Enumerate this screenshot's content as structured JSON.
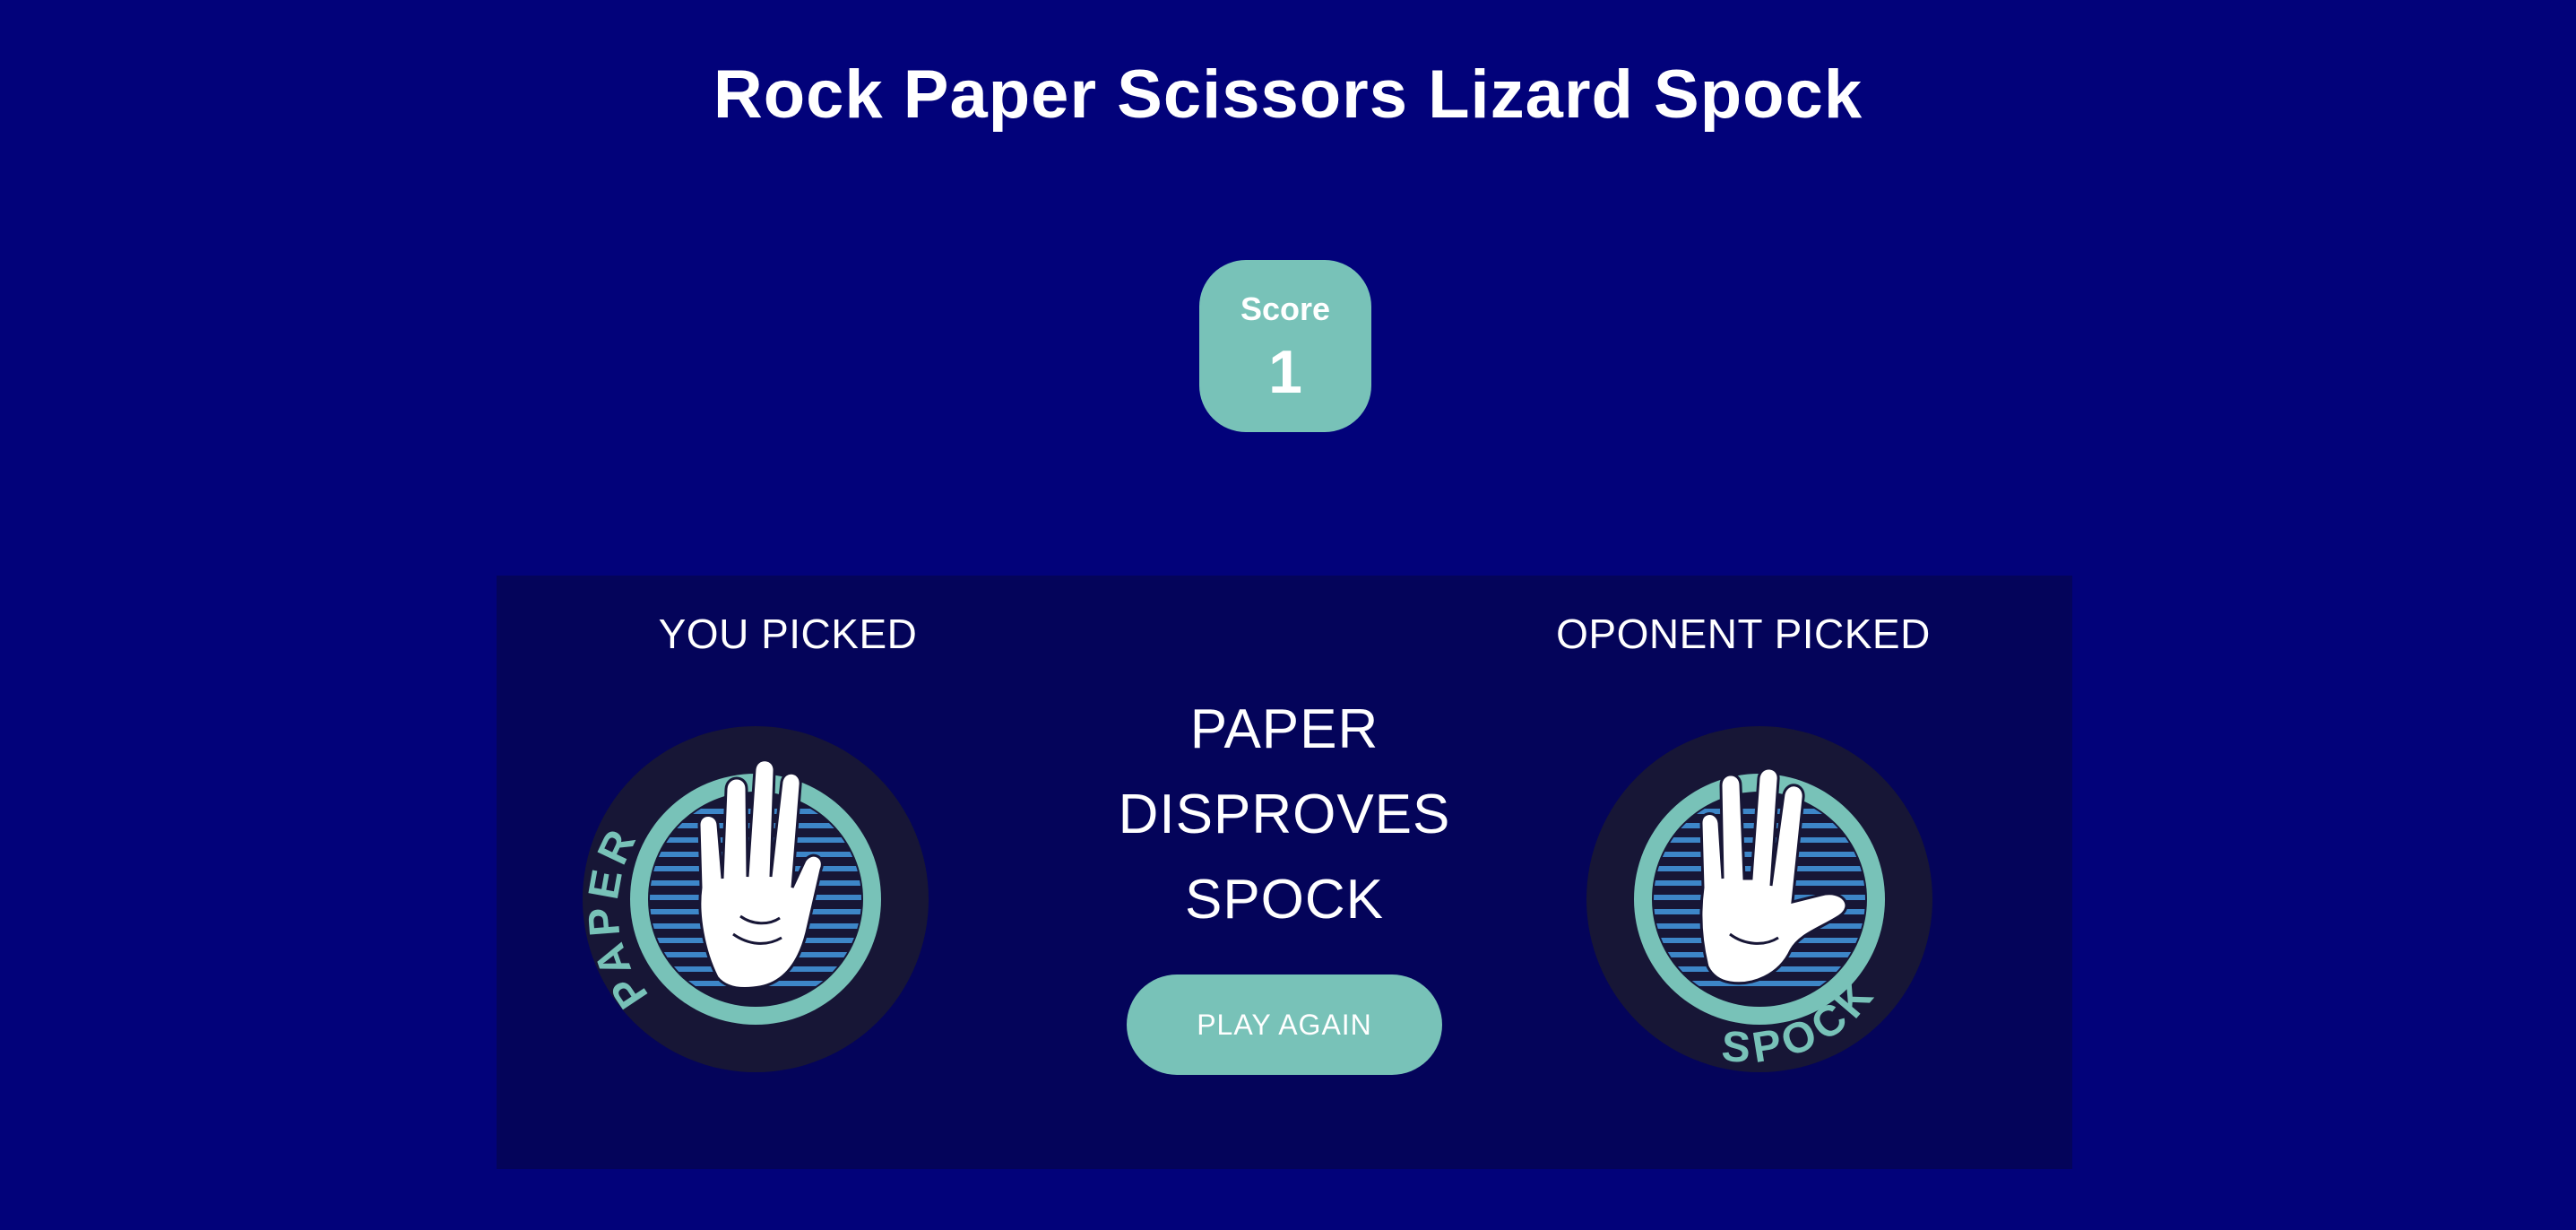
{
  "header": {
    "title": "Rock Paper Scissors Lizard Spock"
  },
  "score": {
    "label": "Score",
    "value": "1"
  },
  "result": {
    "you_picked_label": "YOU PICKED",
    "opponent_picked_label": "OPONENT PICKED",
    "message_lines": [
      "PAPER",
      "DISPROVES",
      "SPOCK"
    ],
    "play_again_label": "PLAY AGAIN",
    "player_choice": {
      "label": "PAPER",
      "icon": "paper-hand-icon"
    },
    "opponent_choice": {
      "label": "SPOCK",
      "icon": "spock-hand-icon"
    }
  },
  "colors": {
    "background": "#02027a",
    "panel": "#04045a",
    "accent": "#78c2b8",
    "token_dark": "#171636",
    "stripe": "#3d86c8"
  }
}
